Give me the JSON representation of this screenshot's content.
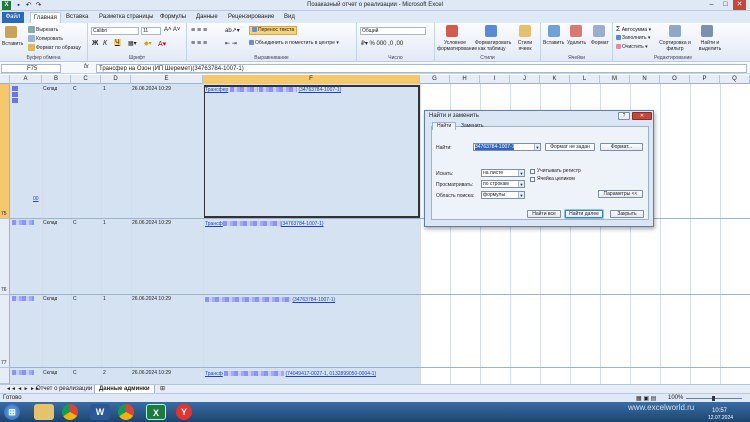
{
  "window": {
    "title": "Позаказный отчет о реализации - Microsoft Excel",
    "min": "–",
    "max": "□",
    "close": "✕"
  },
  "tabs": [
    "Файл",
    "Главная",
    "Вставка",
    "Разметка страницы",
    "Формулы",
    "Данные",
    "Рецензирование",
    "Вид"
  ],
  "ribbon": {
    "clipboard": {
      "paste": "Вставить",
      "cut": "Вырезать",
      "copy": "Копировать",
      "format_painter": "Формат по образцу",
      "label": "Буфер обмена"
    },
    "font": {
      "name": "Calibri",
      "size": "11",
      "label": "Шрифт"
    },
    "alignment": {
      "wrap": "Перенос текста",
      "merge": "Объединить и поместить в центре",
      "label": "Выравнивание"
    },
    "number": {
      "format": "Общий",
      "label": "Число"
    },
    "styles": {
      "conditional": "Условное форматирование",
      "as_table": "Форматировать как таблицу",
      "cell_styles": "Стили ячеек",
      "label": "Стили"
    },
    "cells": {
      "insert": "Вставить",
      "delete": "Удалить",
      "format": "Формат",
      "label": "Ячейки"
    },
    "editing": {
      "autosum": "Автосумма",
      "fill": "Заполнить",
      "clear": "Очистить",
      "sort": "Сортировка и фильтр",
      "find": "Найти и выделить",
      "label": "Редактирование"
    }
  },
  "formula_bar": {
    "name_box": "F75",
    "fx": "fx",
    "content": "Трансфер на Озон (ИП Шеремет)(34763784-1007-1)"
  },
  "columns": [
    "A",
    "B",
    "C",
    "D",
    "E",
    "F",
    "G",
    "H",
    "I",
    "J",
    "K",
    "L",
    "M",
    "N",
    "O",
    "P",
    "Q"
  ],
  "rows": [
    {
      "num": "75",
      "b": "Склад",
      "c": "С",
      "c2": "1",
      "e": "26.06.2024 10:29",
      "f_prefix": "Трансфер",
      "f_link": "(34763784-1007-1)",
      "a_link": "00"
    },
    {
      "num": "76",
      "b": "Склад",
      "c": "С",
      "c2": "1",
      "e": "26.06.2024 10:29",
      "f_prefix": "Трансф",
      "f_link": "(34763784-1007-1)",
      "a_link": ""
    },
    {
      "num": "77",
      "b": "Склад",
      "c": "С",
      "c2": "1",
      "e": "26.06.2024 10:29",
      "f_prefix": "",
      "f_link": "(34763784-1007-1)",
      "a_link": ""
    },
    {
      "num": "",
      "b": "Склад",
      "c": "С",
      "c2": "2",
      "e": "26.06.2024 10:29",
      "f_prefix": "Трансф",
      "f_link": "(74049417-0027-1, 0132899050-0004-1)",
      "a_link": ""
    }
  ],
  "sheets": [
    "Отчет о реализации",
    "Данные админки"
  ],
  "status": {
    "ready": "Готово",
    "zoom": "100%"
  },
  "taskbar": {
    "time": "10:57",
    "date": "12.07.2024",
    "watermark": "www.excelworld.ru"
  },
  "dialog": {
    "title": "Найти и заменить",
    "help": "?",
    "close": "✕",
    "tab_find": "Найти",
    "tab_replace": "Заменить",
    "find_label": "Найти:",
    "find_value": "34763784-1007-1",
    "format_status": "Формат не задан",
    "format_btn": "Формат...",
    "search_label": "Искать:",
    "search_value": "на листе",
    "look_label": "Просматривать:",
    "look_value": "по строкам",
    "area_label": "Область поиска:",
    "area_value": "формулы",
    "match_case": "Учитывать регистр",
    "whole_cell": "Ячейка целиком",
    "params_btn": "Параметры <<",
    "find_all": "Найти все",
    "find_next": "Найти далее",
    "close_btn": "Закрыть"
  }
}
